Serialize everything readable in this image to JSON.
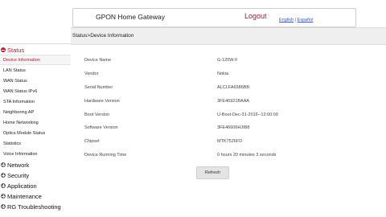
{
  "header": {
    "title": "GPON Home Gateway",
    "logout_label": "Logout",
    "lang_english": "English",
    "lang_separator": "|",
    "lang_spanish": "Español"
  },
  "breadcrumb": "Status>Device Information",
  "sidebar": {
    "status_label": "Status",
    "status_items": [
      "Device Information",
      "LAN Status",
      "WAN Status",
      "WAN Status IPv6",
      "STA Information",
      "Neighboring AP",
      "Home Networking",
      "Optics Module Status",
      "Statistics",
      "Voice Information"
    ],
    "sections": [
      "Network",
      "Security",
      "Application",
      "Maintenance",
      "RG Troubleshooting"
    ]
  },
  "device_info": {
    "rows": [
      {
        "label": "Device Name",
        "value": "G-120W-F"
      },
      {
        "label": "Vendor",
        "value": "Nokia"
      },
      {
        "label": "Serial Number",
        "value": "ALCLFA6986BB"
      },
      {
        "label": "Hardware Version",
        "value": "3FE46921BAAA"
      },
      {
        "label": "Boot Version",
        "value": "U-Boot-Dec-31-2016--12:00:00"
      },
      {
        "label": "Software Version",
        "value": "3FE46606HJIB8"
      },
      {
        "label": "Chipset",
        "value": "MTK7526FD"
      },
      {
        "label": "Device Running Time",
        "value": "0 hours 20 minutes 3 seconds"
      }
    ]
  },
  "refresh_label": "Refresh",
  "colors": {
    "accent": "#b01c2e",
    "logout": "#8a1f2f",
    "link": "#3355bb"
  }
}
